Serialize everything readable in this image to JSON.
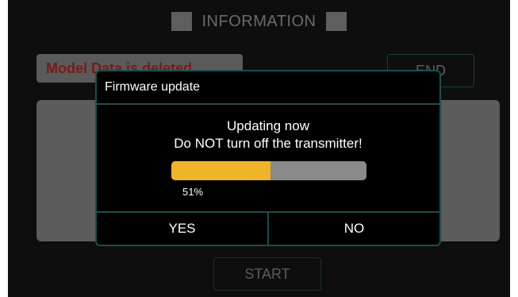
{
  "background": {
    "title": "INFORMATION",
    "model_label": "Model Data is deleted",
    "end_label": "END",
    "start_label": "START"
  },
  "dialog": {
    "title": "Firmware update",
    "message_line1": "Updating now",
    "message_line2": "Do NOT turn off the transmitter!",
    "progress_value": 0.51,
    "progress_text": "51%",
    "yes_label": "YES",
    "no_label": "NO"
  },
  "colors": {
    "progress_fill": "#f0b429",
    "progress_track": "#8a8a8a",
    "dialog_border": "#1f4e4e",
    "model_label_text": "#7a1a1a"
  }
}
